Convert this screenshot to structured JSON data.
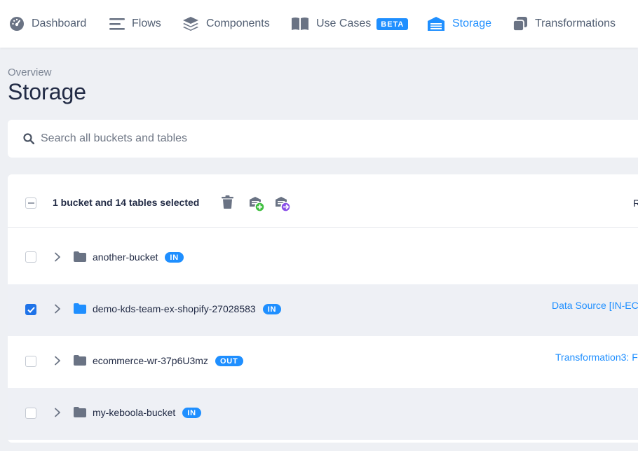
{
  "nav": {
    "items": [
      {
        "label": "Dashboard",
        "icon": "dashboard-gauge-icon"
      },
      {
        "label": "Flows",
        "icon": "flows-lines-icon"
      },
      {
        "label": "Components",
        "icon": "components-layers-icon"
      },
      {
        "label": "Use Cases",
        "icon": "use-cases-book-icon",
        "badge": "BETA"
      },
      {
        "label": "Storage",
        "icon": "storage-warehouse-icon",
        "active": true
      },
      {
        "label": "Transformations",
        "icon": "transformations-icon"
      }
    ]
  },
  "breadcrumb": "Overview",
  "title": "Storage",
  "search": {
    "placeholder": "Search all buckets and tables",
    "value": ""
  },
  "selection": {
    "text": "1 bucket and 14 tables selected",
    "actions": [
      "delete-icon",
      "add-bucket-icon",
      "move-bucket-icon"
    ],
    "column_label_cut": "R"
  },
  "buckets": [
    {
      "name": "another-bucket",
      "stage": "IN",
      "checked": false,
      "link": ""
    },
    {
      "name": "demo-kds-team-ex-shopify-27028583",
      "stage": "IN",
      "checked": true,
      "link": "Data Source [IN-EC"
    },
    {
      "name": "ecommerce-wr-37p6U3mz",
      "stage": "OUT",
      "checked": false,
      "link": "Transformation3: F"
    },
    {
      "name": "my-keboola-bucket",
      "stage": "IN",
      "checked": false,
      "link": ""
    }
  ],
  "colors": {
    "accent": "#1f8fff",
    "checkbox": "#1f73e8",
    "add": "#3fbf3f",
    "move": "#8a4fe8"
  }
}
